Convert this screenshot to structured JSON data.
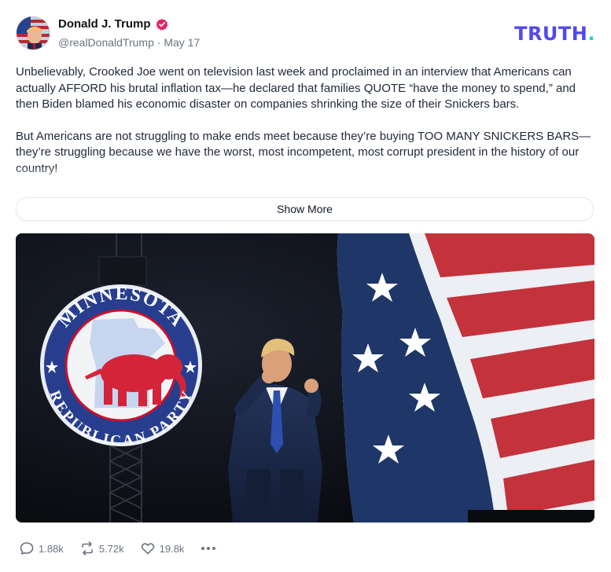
{
  "author": {
    "display_name": "Donald J. Trump",
    "handle": "@realDonaldTrump",
    "date": "May 17",
    "separator": "·",
    "verified_icon": "verified-badge-icon"
  },
  "brand": {
    "logo_text": "TRUTH",
    "logo_dot": ".",
    "logo_color": "#5448EE",
    "dot_color": "#23D5B3"
  },
  "post": {
    "paragraphs": [
      "Unbelievably, Crooked Joe went on television last week and proclaimed in an interview that Americans can actually AFFORD his brutal inflation tax—he declared that families QUOTE “have the money to spend,” and then Biden blamed his economic disaster on companies shrinking the size of their Snickers bars.",
      "But Americans are not struggling to make ends meet because they’re buying TOO MANY SNICKERS BARS—they’re struggling because we have the worst, most incompetent, most corrupt president in the history of our country!"
    ],
    "show_more_label": "Show More"
  },
  "media": {
    "seal_top_text": "MINNESOTA",
    "seal_bottom_text": "REPUBLICAN PARTY"
  },
  "actions": {
    "replies": "1.88k",
    "retruths": "5.72k",
    "likes": "19.8k",
    "reply_icon": "comment-icon",
    "retruth_icon": "retruth-icon",
    "like_icon": "heart-icon",
    "more_icon": "more-dots-icon"
  }
}
